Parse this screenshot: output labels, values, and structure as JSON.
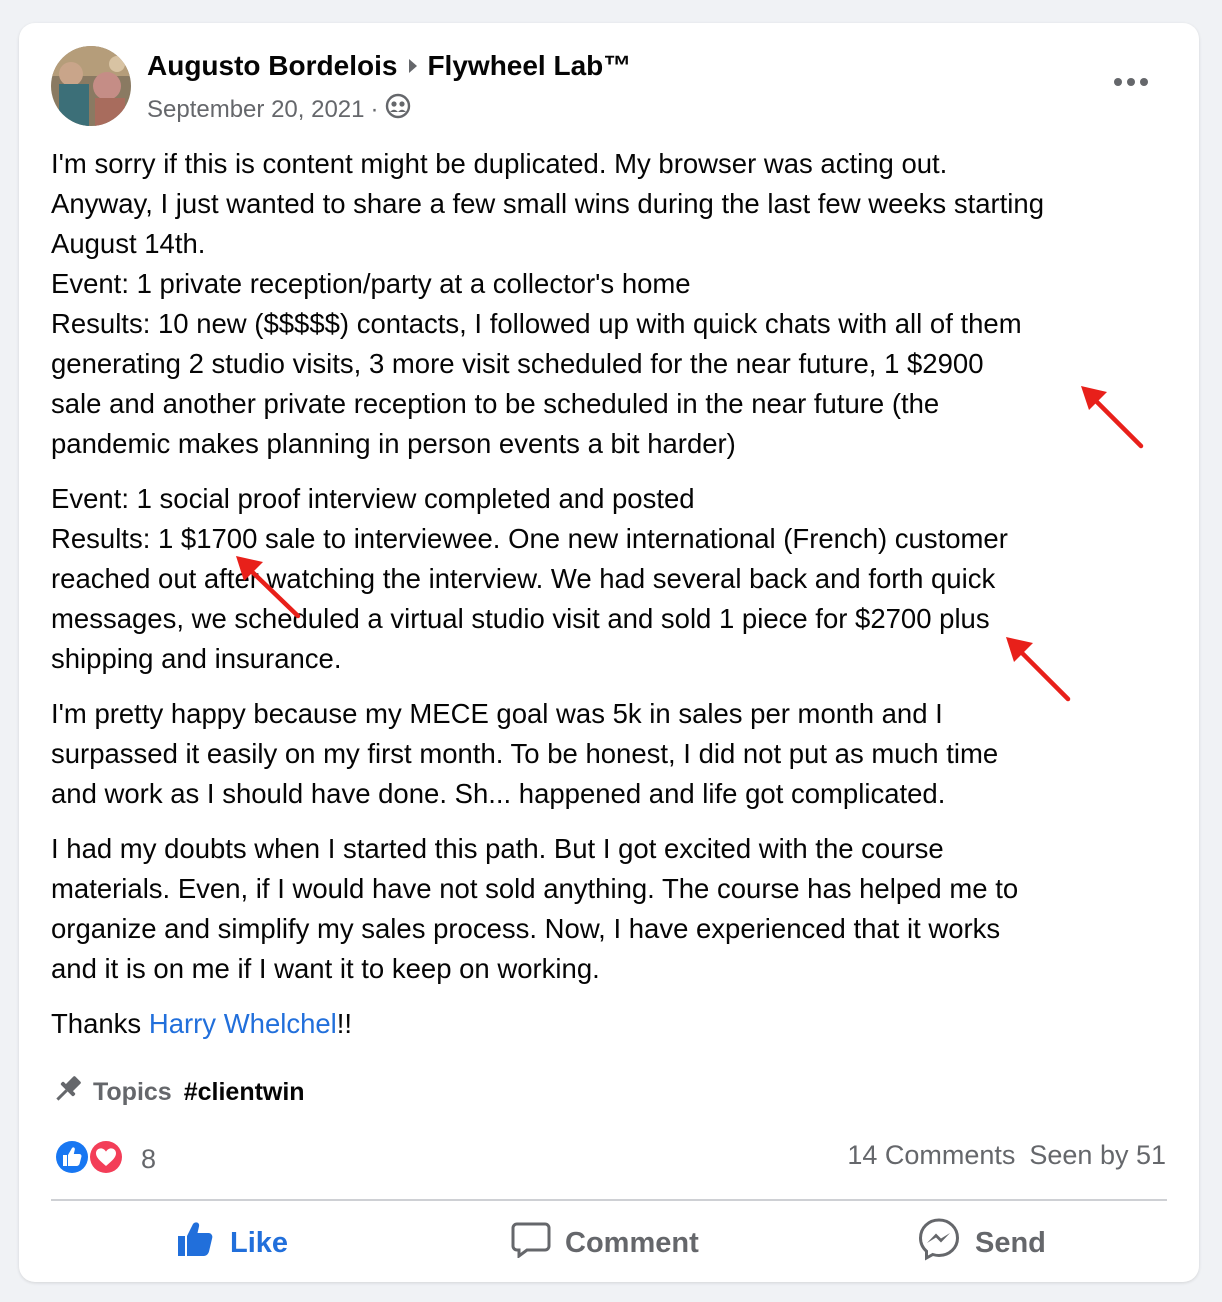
{
  "post": {
    "author": "Augusto Bordelois",
    "group": "Flywheel Lab™",
    "date": "September 20, 2021",
    "date_separator": "·",
    "privacy_icon": "group-members-icon",
    "paragraphs": [
      {
        "lines": [
          "I'm sorry if this is content might be duplicated. My browser was acting out.",
          "Anyway, I just wanted to share a few small wins during the last few weeks starting",
          "August 14th.",
          "Event: 1 private reception/party at a collector's home",
          "Results: 10 new ($$$$$) contacts, I followed up with quick chats with all of them",
          "generating 2 studio visits, 3 more visit scheduled for the near future, 1 $2900",
          "sale and another private reception to be scheduled in the near future (the",
          "pandemic makes planning in person events a bit harder)"
        ]
      },
      {
        "lines": [
          "Event: 1 social proof interview completed and posted",
          "Results: 1 $1700 sale to interviewee. One new international (French) customer",
          "reached out after watching the interview. We had several back and forth quick",
          "messages, we scheduled a virtual studio visit and sold 1 piece for $2700 plus",
          "shipping and insurance."
        ]
      },
      {
        "lines": [
          "I'm pretty happy because my MECE goal was 5k in sales per month and I",
          "surpassed it easily on my first month. To be honest, I did not put as much time",
          "and work as I should have done. Sh... happened and life got complicated."
        ]
      },
      {
        "lines": [
          "I had my doubts when I started this path. But I got excited with the course",
          "materials. Even, if I would have not sold anything. The course has helped me to",
          "organize and simplify my sales process. Now, I have experienced that it works",
          "and it is on me if I want it to keep on working."
        ]
      }
    ],
    "thanks_prefix": "Thanks ",
    "thanks_mention": "Harry Whelchel",
    "thanks_suffix": "!!",
    "topics_label": "Topics",
    "topic_tag": "#clientwin",
    "reaction_count": "8",
    "comments_label": "14 Comments",
    "seen_label": "Seen by 51",
    "actions": {
      "like": "Like",
      "comment": "Comment",
      "send": "Send"
    }
  },
  "colors": {
    "accent": "#216fdb",
    "annotation_arrow": "#e8201a",
    "love": "#f33e58"
  }
}
